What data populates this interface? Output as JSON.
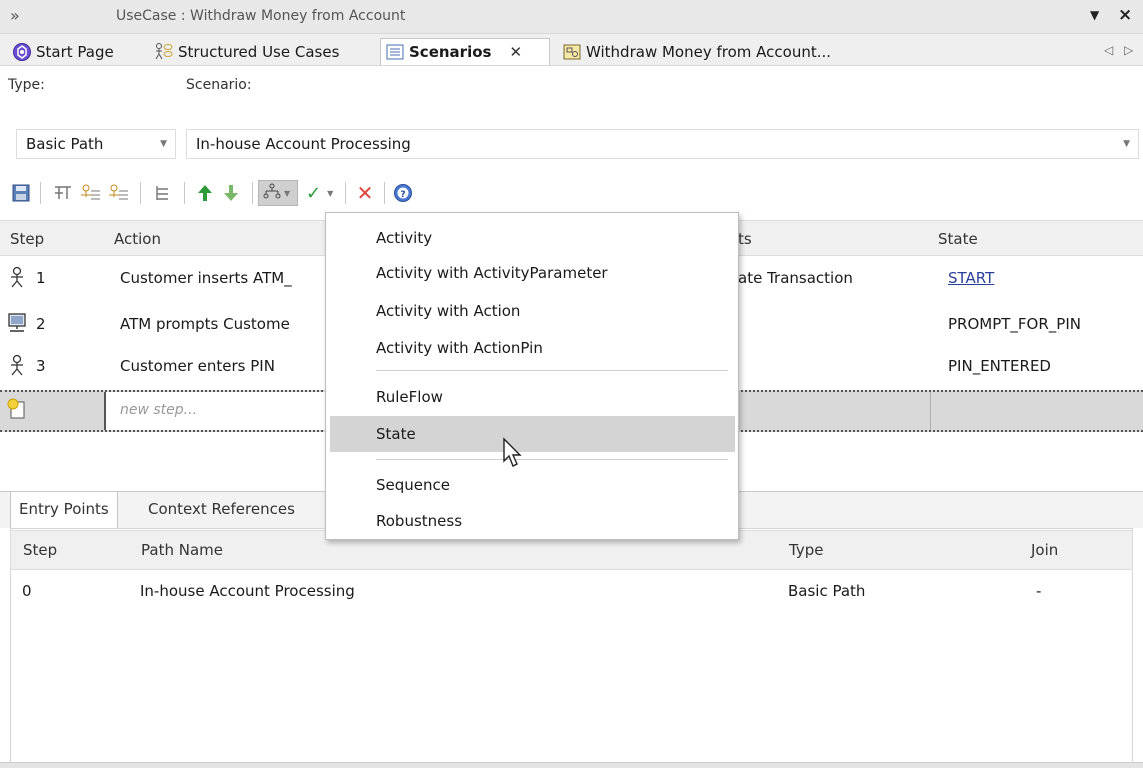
{
  "window": {
    "title": "UseCase : Withdraw Money from Account"
  },
  "tabs": [
    {
      "label": "Start Page",
      "icon": "start-page-icon"
    },
    {
      "label": "Structured Use Cases",
      "icon": "structured-usecases-icon"
    },
    {
      "label": "Scenarios",
      "icon": "scenarios-icon",
      "active": true
    },
    {
      "label": "Withdraw Money from Account...",
      "icon": "diagram-icon"
    }
  ],
  "type_field": {
    "label": "Type:",
    "value": "Basic Path"
  },
  "scenario_field": {
    "label": "Scenario:",
    "value": "In-house Account Processing"
  },
  "steps_table": {
    "headers": {
      "step": "Step",
      "action": "Action",
      "uses": "ts",
      "state": "State"
    },
    "rows": [
      {
        "step": "1",
        "action": "Customer inserts ATM_",
        "uses": "ate Transaction",
        "state": "START",
        "actor": "actor-icon"
      },
      {
        "step": "2",
        "action": "ATM prompts Custome",
        "uses": "",
        "state": "PROMPT_FOR_PIN",
        "actor": "computer-icon"
      },
      {
        "step": "3",
        "action": "Customer enters PIN",
        "uses": "",
        "state": "PIN_ENTERED",
        "actor": "actor-icon"
      }
    ],
    "new_step_placeholder": "new step..."
  },
  "bottom_tabs": [
    {
      "label": "Entry Points",
      "active": true
    },
    {
      "label": "Context References"
    }
  ],
  "entry_points": {
    "headers": {
      "step": "Step",
      "path_name": "Path Name",
      "type": "Type",
      "join": "Join"
    },
    "rows": [
      {
        "step": "0",
        "path_name": "In-house Account Processing",
        "type": "Basic Path",
        "join": "-"
      }
    ]
  },
  "generate_menu": {
    "items": [
      {
        "label": "Activity"
      },
      {
        "label": "Activity with ActivityParameter"
      },
      {
        "label": "Activity with Action"
      },
      {
        "label": "Activity with ActionPin"
      },
      {
        "label": "RuleFlow"
      },
      {
        "label": "State",
        "highlighted": true
      },
      {
        "label": "Sequence"
      },
      {
        "label": "Robustness"
      }
    ]
  },
  "colors": {
    "link": "#2a3f9c",
    "highlight": "#d4d4d4",
    "up_arrow": "#2e9a3a",
    "delete": "#e0443c"
  }
}
